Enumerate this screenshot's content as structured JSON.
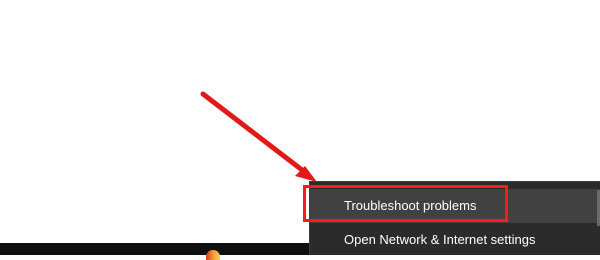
{
  "context_menu": {
    "items": [
      {
        "label": "Troubleshoot problems"
      },
      {
        "label": "Open Network & Internet settings"
      }
    ]
  },
  "annotation": {
    "highlight_color": "#ff1a1a",
    "arrow_color": "#e01919"
  },
  "taskbar": {
    "background": "#101010",
    "icon": "firefox-icon"
  }
}
